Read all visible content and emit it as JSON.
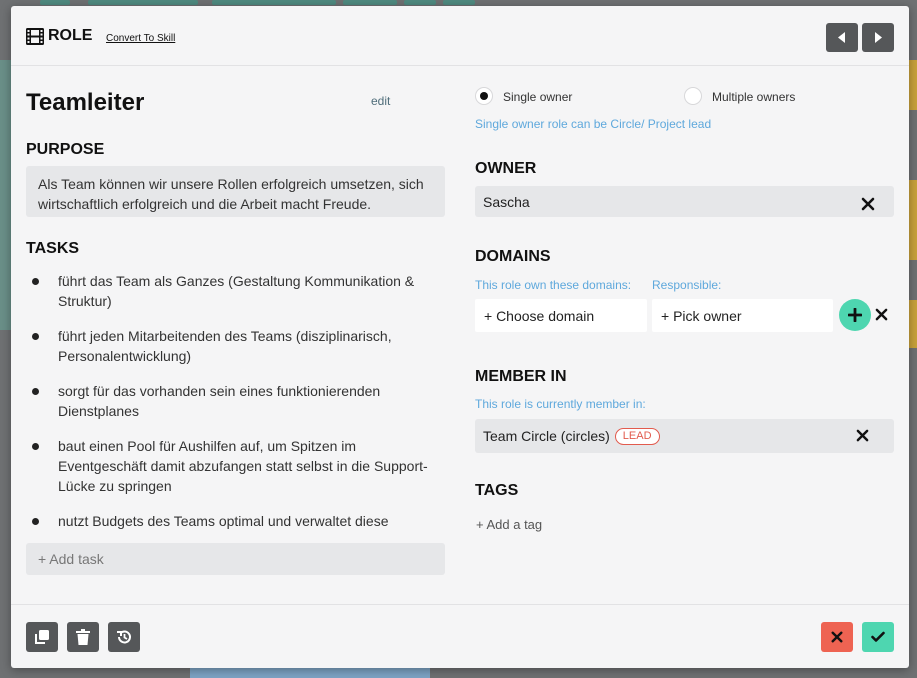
{
  "header": {
    "title": "ROLE",
    "convert_link": "Convert To Skill"
  },
  "role": {
    "name": "Teamleiter",
    "edit_label": "edit"
  },
  "purpose": {
    "label": "PURPOSE",
    "text": "Als Team können wir unsere Rollen erfolgreich umsetzen, sich wirtschaftlich erfolgreich und die Arbeit macht Freude."
  },
  "tasks": {
    "label": "TASKS",
    "items": [
      "führt das Team als Ganzes (Gestaltung Kommunikation & Struktur)",
      "führt jeden Mitarbeitenden des Teams (disziplinarisch, Personalentwicklung)",
      "sorgt für das vorhanden sein eines funktionierenden Dienstplanes",
      "baut einen Pool für Aushilfen auf, um Spitzen im Eventgeschäft damit abzufangen statt selbst in die Support-Lücke zu springen",
      "nutzt Budgets des Teams optimal und verwaltet diese"
    ],
    "add_placeholder": "+ Add task"
  },
  "ownership": {
    "single_label": "Single owner",
    "multiple_label": "Multiple owners",
    "selected": "single",
    "hint": "Single owner role can be Circle/ Project lead"
  },
  "owner": {
    "label": "OWNER",
    "value": "Sascha"
  },
  "domains": {
    "label": "DOMAINS",
    "domains_hint": "This role own these domains:",
    "responsible_hint": "Responsible:",
    "choose_domain": "+ Choose domain",
    "pick_owner": "+ Pick owner"
  },
  "member_in": {
    "label": "MEMBER IN",
    "hint": "This role is currently member in:",
    "circle": "Team Circle (circles)",
    "badge": "LEAD"
  },
  "tags": {
    "label": "TAGS",
    "add_label": "+ Add a tag"
  },
  "colors": {
    "accent_green": "#4ed6b0",
    "danger_red": "#ee6352",
    "hint_blue": "#5ea8dc",
    "dark_button": "#555759"
  }
}
